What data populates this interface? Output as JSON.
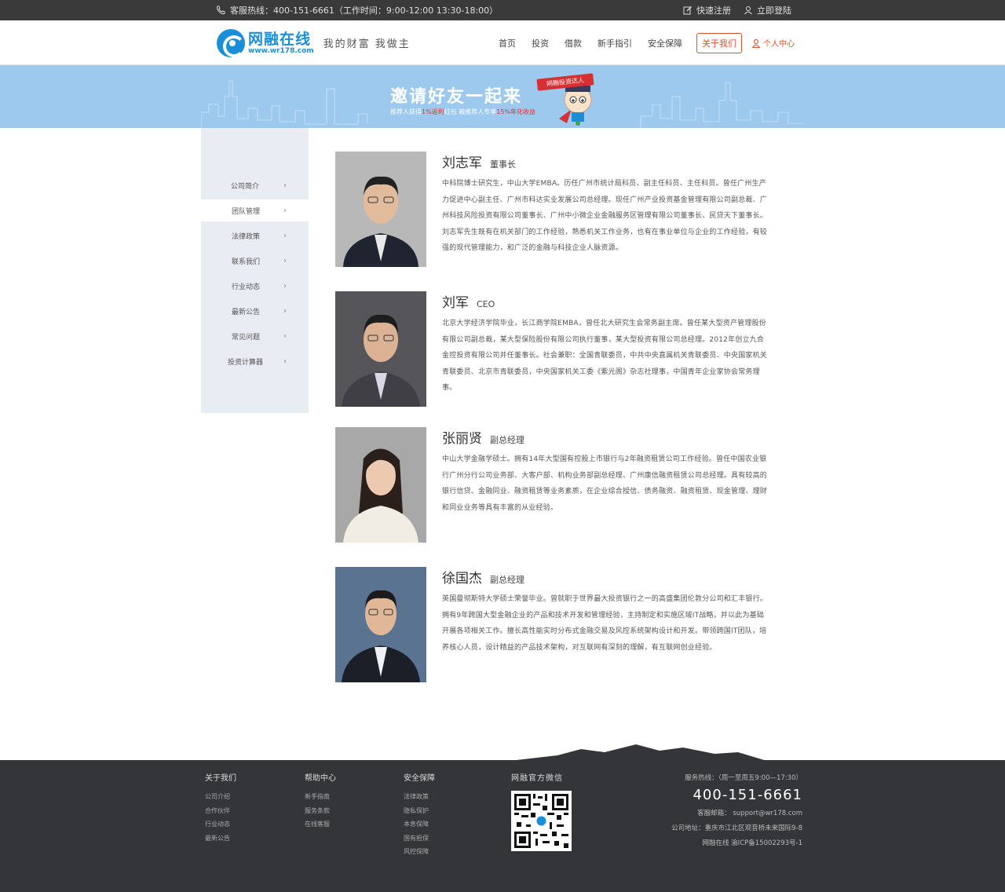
{
  "topbar": {
    "hotline": "客服热线：400-151-6661（工作时间：9:00-12:00 13:30-18:00）",
    "register": "快速注册",
    "login": "立即登陆"
  },
  "header": {
    "logo_name": "网融在线",
    "logo_url": "www.wr178.com",
    "slogan": "我的财富  我做主",
    "nav": [
      "首页",
      "投资",
      "借款",
      "新手指引",
      "安全保障",
      "关于我们"
    ],
    "user_center": "个人中心"
  },
  "banner": {
    "title": "邀请好友一起来",
    "sub_prefix": "推荐人获得",
    "sub_hl1": "1%返利",
    "sub_mid": "红包 被推荐人专享",
    "sub_hl2": "15%年化收益",
    "ribbon": "网融投资达人"
  },
  "sidebar": {
    "items": [
      "公司简介",
      "团队管理",
      "法律政策",
      "联系我们",
      "行业动态",
      "最新公告",
      "常见问题",
      "投资计算器"
    ],
    "active": 1
  },
  "team": [
    {
      "name": "刘志军",
      "title": "董事长",
      "desc": "中科院博士研究生，中山大学EMBA。历任广州市统计局科员、副主任科员、主任科员。曾任广州生产力促进中心副主任、广州市科达实业发展公司总经理。现任广州产业投资基金管理有限公司副总裁、广州科技风险投资有限公司董事长、广州中小微企业金融服务区管理有限公司董事长、民贷天下董事长。刘志军先生既有在机关部门的工作经验，熟悉机关工作业务，也有在事业单位与企业的工作经验，有较强的现代管理能力，和广泛的金融与科技企业人脉资源。"
    },
    {
      "name": "刘军",
      "title": "CEO",
      "desc": "北京大学经济学院毕业，长江商学院EMBA，曾任北大研究生会常务副主席。曾任某大型资产管理股份有限公司副总裁，某大型保险股份有限公司执行董事，某大型投资有限公司总经理。2012年创立九合金控投资有限公司并任董事长。社会兼职：全国青联委员，中共中央直属机关青联委员、中央国家机关青联委员、北京市青联委员，中央国家机关工委《紫光阁》杂志社理事，中国青年企业家协会常务理事。"
    },
    {
      "name": "张丽贤",
      "title": "副总经理",
      "desc": "中山大学金融学硕士。拥有14年大型国有控股上市银行与2年融资租赁公司工作经验。曾任中国农业银行广州分行公司业务部、大客户部、机构业务部副总经理、广州康信融资租赁公司总经理。具有较高的银行信贷、金融同业、融资租赁等业务素质，在企业综合授信、债务融资、融资租赁、现金管理、理财和同业业务等具有丰富的从业经验。"
    },
    {
      "name": "徐国杰",
      "title": "副总经理",
      "desc": "英国曼彻斯特大学硕士荣誉毕业。曾就职于世界最大投资银行之一的高盛集团伦敦分公司和汇丰银行。拥有9年跨国大型金融企业的产品和技术开发和管理经验，主持制定和实施区域IT战略，并以此为基础开展各项相关工作。擅长高性能实时分布式金融交易及风控系统架构设计和开发。带领跨国IT团队，培养核心人员，设计精益的产品技术架构，对互联网有深刻的理解，有互联网创业经验。"
    }
  ],
  "footer": {
    "cols": [
      {
        "heading": "关于我们",
        "items": [
          "公司介绍",
          "合作伙伴",
          "行业动态",
          "最新公告"
        ]
      },
      {
        "heading": "帮助中心",
        "items": [
          "新手指南",
          "服务条款",
          "在线客服"
        ]
      },
      {
        "heading": "安全保障",
        "items": [
          "法律政策",
          "隐私保护",
          "本息保障",
          "国有担保",
          "风控保障"
        ]
      }
    ],
    "wechat": "网融官方微信",
    "service_hours": "服务热线：（周一至周五9:00—17:30）",
    "phone": "400-151-6661",
    "email": "客服邮箱： support@wr178.com",
    "address": "公司地址：重庆市江北区观音桥未来国际9-8",
    "icp": "网融在线  渝ICP备15002293号-1"
  },
  "colors": {
    "accent": "#d9532c",
    "brand": "#1a8fd8",
    "banner": "#9dc9ef",
    "footer": "#333538"
  }
}
